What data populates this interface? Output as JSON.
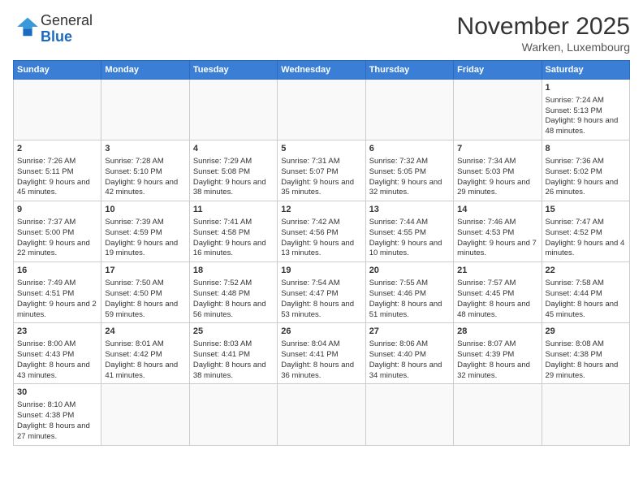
{
  "header": {
    "logo_general": "General",
    "logo_blue": "Blue",
    "month_title": "November 2025",
    "location": "Warken, Luxembourg"
  },
  "weekdays": [
    "Sunday",
    "Monday",
    "Tuesday",
    "Wednesday",
    "Thursday",
    "Friday",
    "Saturday"
  ],
  "weeks": [
    [
      {
        "day": "",
        "info": ""
      },
      {
        "day": "",
        "info": ""
      },
      {
        "day": "",
        "info": ""
      },
      {
        "day": "",
        "info": ""
      },
      {
        "day": "",
        "info": ""
      },
      {
        "day": "",
        "info": ""
      },
      {
        "day": "1",
        "info": "Sunrise: 7:24 AM\nSunset: 5:13 PM\nDaylight: 9 hours and 48 minutes."
      }
    ],
    [
      {
        "day": "2",
        "info": "Sunrise: 7:26 AM\nSunset: 5:11 PM\nDaylight: 9 hours and 45 minutes."
      },
      {
        "day": "3",
        "info": "Sunrise: 7:28 AM\nSunset: 5:10 PM\nDaylight: 9 hours and 42 minutes."
      },
      {
        "day": "4",
        "info": "Sunrise: 7:29 AM\nSunset: 5:08 PM\nDaylight: 9 hours and 38 minutes."
      },
      {
        "day": "5",
        "info": "Sunrise: 7:31 AM\nSunset: 5:07 PM\nDaylight: 9 hours and 35 minutes."
      },
      {
        "day": "6",
        "info": "Sunrise: 7:32 AM\nSunset: 5:05 PM\nDaylight: 9 hours and 32 minutes."
      },
      {
        "day": "7",
        "info": "Sunrise: 7:34 AM\nSunset: 5:03 PM\nDaylight: 9 hours and 29 minutes."
      },
      {
        "day": "8",
        "info": "Sunrise: 7:36 AM\nSunset: 5:02 PM\nDaylight: 9 hours and 26 minutes."
      }
    ],
    [
      {
        "day": "9",
        "info": "Sunrise: 7:37 AM\nSunset: 5:00 PM\nDaylight: 9 hours and 22 minutes."
      },
      {
        "day": "10",
        "info": "Sunrise: 7:39 AM\nSunset: 4:59 PM\nDaylight: 9 hours and 19 minutes."
      },
      {
        "day": "11",
        "info": "Sunrise: 7:41 AM\nSunset: 4:58 PM\nDaylight: 9 hours and 16 minutes."
      },
      {
        "day": "12",
        "info": "Sunrise: 7:42 AM\nSunset: 4:56 PM\nDaylight: 9 hours and 13 minutes."
      },
      {
        "day": "13",
        "info": "Sunrise: 7:44 AM\nSunset: 4:55 PM\nDaylight: 9 hours and 10 minutes."
      },
      {
        "day": "14",
        "info": "Sunrise: 7:46 AM\nSunset: 4:53 PM\nDaylight: 9 hours and 7 minutes."
      },
      {
        "day": "15",
        "info": "Sunrise: 7:47 AM\nSunset: 4:52 PM\nDaylight: 9 hours and 4 minutes."
      }
    ],
    [
      {
        "day": "16",
        "info": "Sunrise: 7:49 AM\nSunset: 4:51 PM\nDaylight: 9 hours and 2 minutes."
      },
      {
        "day": "17",
        "info": "Sunrise: 7:50 AM\nSunset: 4:50 PM\nDaylight: 8 hours and 59 minutes."
      },
      {
        "day": "18",
        "info": "Sunrise: 7:52 AM\nSunset: 4:48 PM\nDaylight: 8 hours and 56 minutes."
      },
      {
        "day": "19",
        "info": "Sunrise: 7:54 AM\nSunset: 4:47 PM\nDaylight: 8 hours and 53 minutes."
      },
      {
        "day": "20",
        "info": "Sunrise: 7:55 AM\nSunset: 4:46 PM\nDaylight: 8 hours and 51 minutes."
      },
      {
        "day": "21",
        "info": "Sunrise: 7:57 AM\nSunset: 4:45 PM\nDaylight: 8 hours and 48 minutes."
      },
      {
        "day": "22",
        "info": "Sunrise: 7:58 AM\nSunset: 4:44 PM\nDaylight: 8 hours and 45 minutes."
      }
    ],
    [
      {
        "day": "23",
        "info": "Sunrise: 8:00 AM\nSunset: 4:43 PM\nDaylight: 8 hours and 43 minutes."
      },
      {
        "day": "24",
        "info": "Sunrise: 8:01 AM\nSunset: 4:42 PM\nDaylight: 8 hours and 41 minutes."
      },
      {
        "day": "25",
        "info": "Sunrise: 8:03 AM\nSunset: 4:41 PM\nDaylight: 8 hours and 38 minutes."
      },
      {
        "day": "26",
        "info": "Sunrise: 8:04 AM\nSunset: 4:41 PM\nDaylight: 8 hours and 36 minutes."
      },
      {
        "day": "27",
        "info": "Sunrise: 8:06 AM\nSunset: 4:40 PM\nDaylight: 8 hours and 34 minutes."
      },
      {
        "day": "28",
        "info": "Sunrise: 8:07 AM\nSunset: 4:39 PM\nDaylight: 8 hours and 32 minutes."
      },
      {
        "day": "29",
        "info": "Sunrise: 8:08 AM\nSunset: 4:38 PM\nDaylight: 8 hours and 29 minutes."
      }
    ],
    [
      {
        "day": "30",
        "info": "Sunrise: 8:10 AM\nSunset: 4:38 PM\nDaylight: 8 hours and 27 minutes."
      },
      {
        "day": "",
        "info": ""
      },
      {
        "day": "",
        "info": ""
      },
      {
        "day": "",
        "info": ""
      },
      {
        "day": "",
        "info": ""
      },
      {
        "day": "",
        "info": ""
      },
      {
        "day": "",
        "info": ""
      }
    ]
  ]
}
